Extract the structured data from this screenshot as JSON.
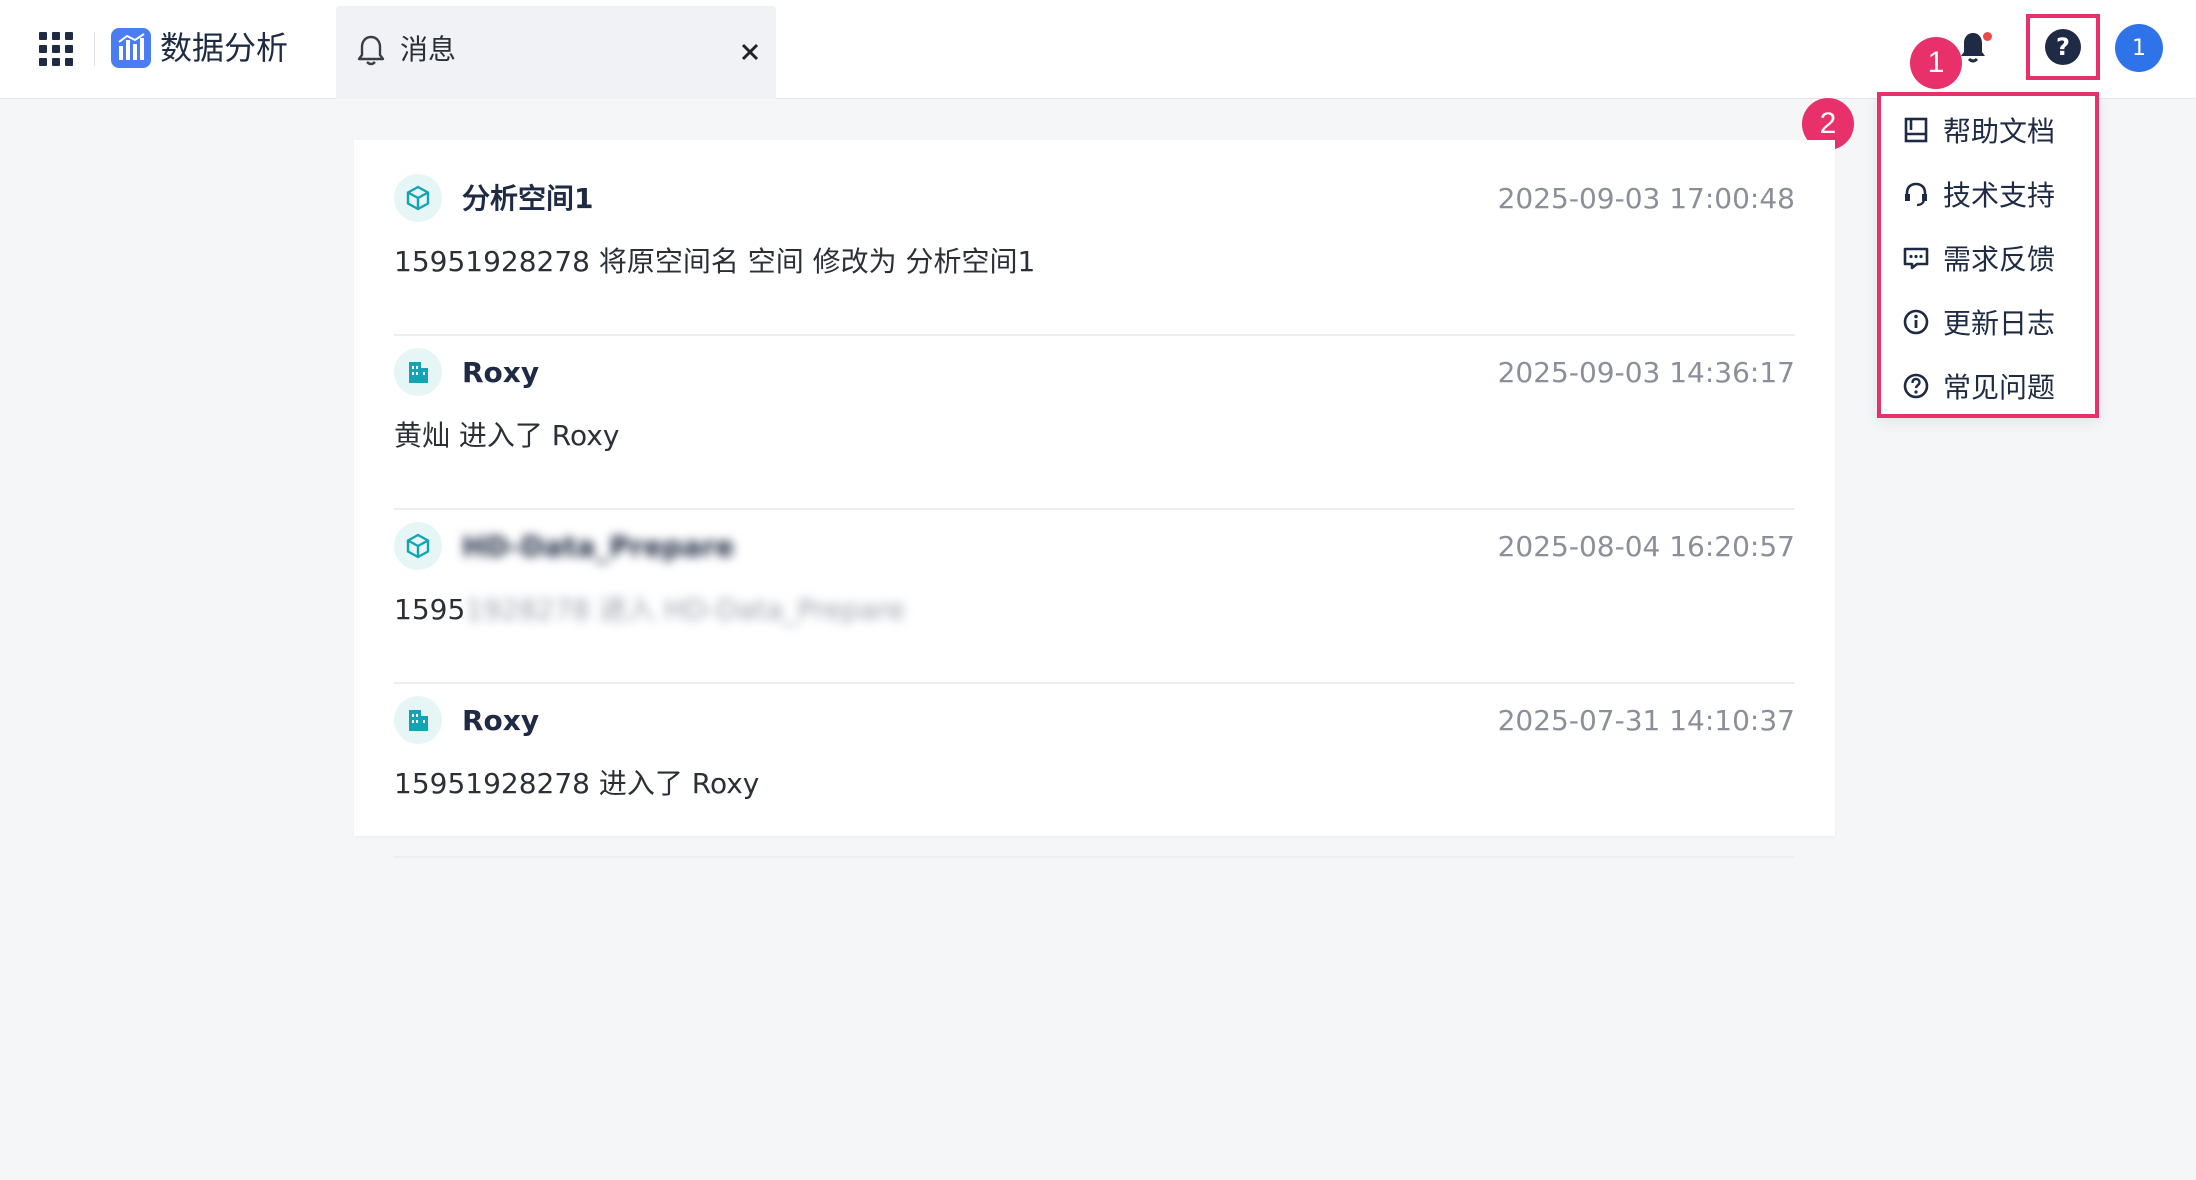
{
  "header": {
    "app_title": "数据分析",
    "tab": {
      "label": "消息",
      "close_symbol": "✕"
    },
    "help_symbol": "?",
    "avatar_text": "1"
  },
  "annotations": {
    "step1": "1",
    "step2": "2"
  },
  "help_menu": {
    "items": [
      {
        "label": "帮助文档",
        "icon": "book-icon"
      },
      {
        "label": "技术支持",
        "icon": "headset-icon"
      },
      {
        "label": "需求反馈",
        "icon": "feedback-icon"
      },
      {
        "label": "更新日志",
        "icon": "info-icon"
      },
      {
        "label": "常见问题",
        "icon": "question-icon"
      }
    ]
  },
  "messages": [
    {
      "title": "分析空间1",
      "time": "2025-09-03 17:00:48",
      "body": "15951928278 将原空间名 空间 修改为 分析空间1",
      "icon": "cube-icon"
    },
    {
      "title": "Roxy",
      "time": "2025-09-03 14:36:17",
      "body": "黄灿 进入了 Roxy",
      "icon": "building-icon"
    },
    {
      "title": "HD-Data_Prepare",
      "time": "2025-08-04 16:20:57",
      "body_visible": "1595",
      "body_blurred": "1928278 进入 HD-Data_Prepare",
      "icon": "cube-icon"
    },
    {
      "title": "Roxy",
      "time": "2025-07-31 14:10:37",
      "body": "15951928278 进入了 Roxy",
      "icon": "building-icon"
    }
  ],
  "colors": {
    "accent": "#e8306a",
    "brand": "#4a7df3",
    "teal": "#12a4b4",
    "avatar": "#2f73e8"
  }
}
